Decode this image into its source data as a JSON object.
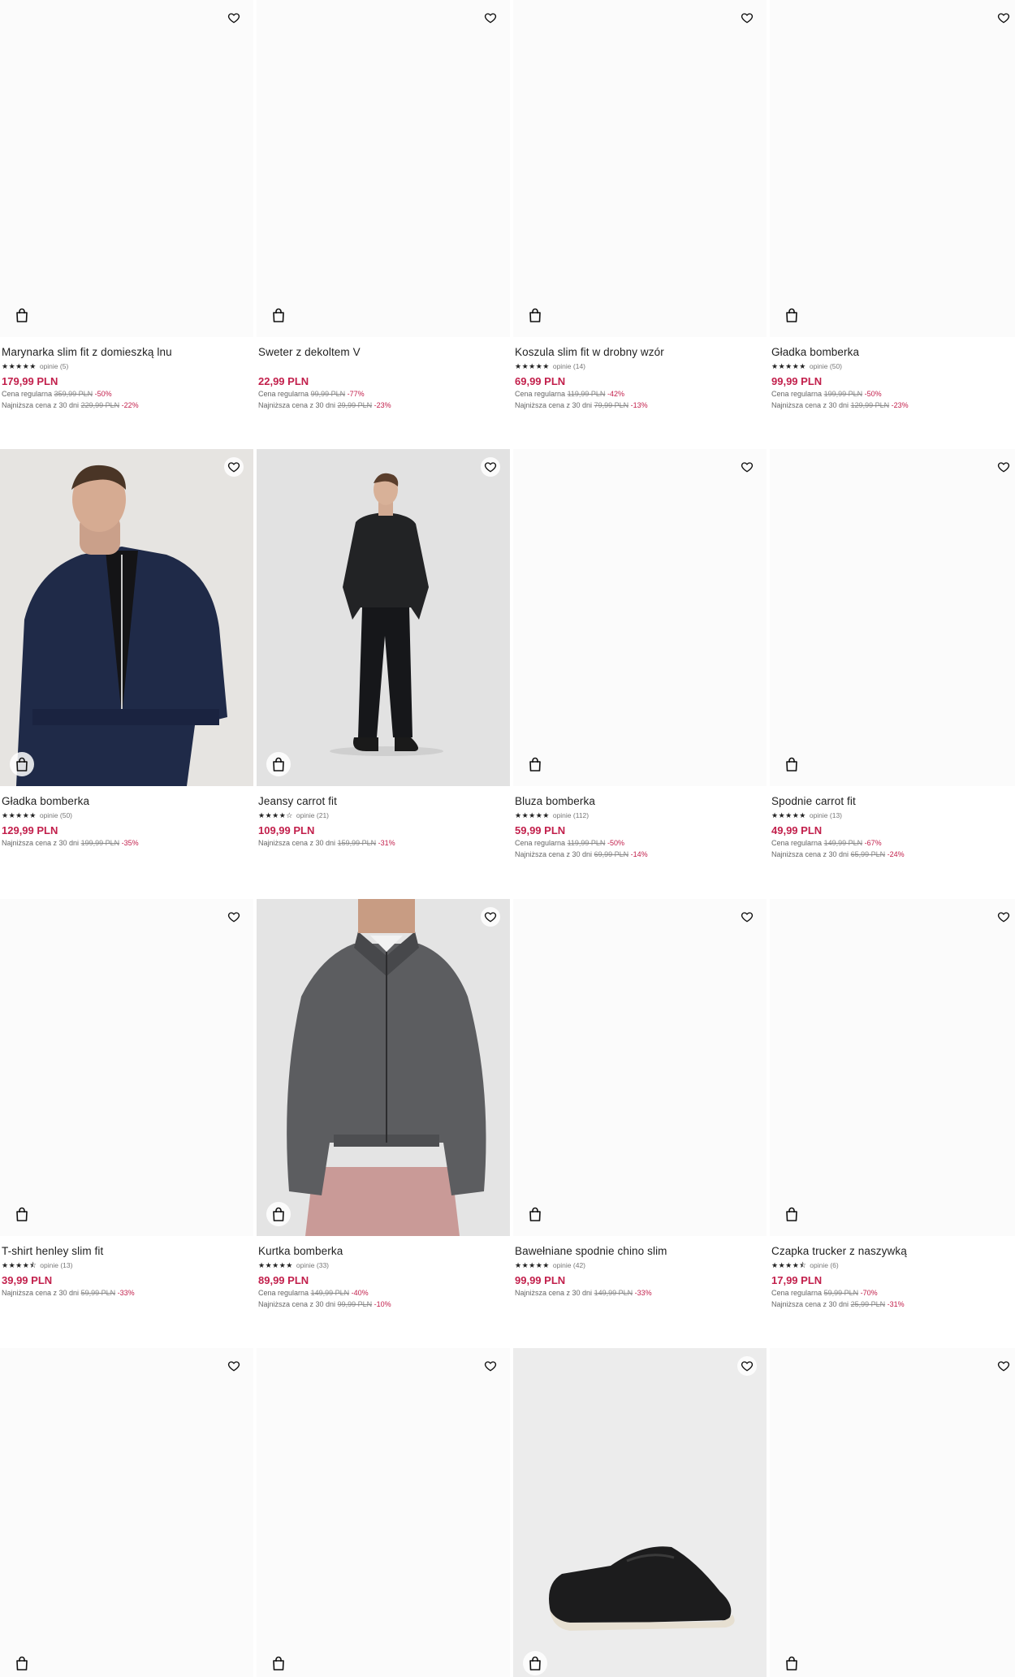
{
  "accent_color": "#c21f4b",
  "icons": {
    "favorite": "heart-outline-icon",
    "bag": "shopping-bag-icon",
    "star": "star-icon"
  },
  "products": [
    {
      "name": "Marynarka slim fit z domieszką lnu",
      "stars": "★★★★★",
      "reviews": "opinie (5)",
      "price": "179,99 PLN",
      "regular_label": "Cena regularna",
      "regular_price": "359,99 PLN",
      "regular_discount": "-50%",
      "lowest_label": "Najniższa cena z 30 dni",
      "lowest_price": "229,99 PLN",
      "lowest_discount": "-22%",
      "photo": "none"
    },
    {
      "name": "Sweter z dekoltem V",
      "stars": "",
      "reviews": "",
      "price": "22,99 PLN",
      "regular_label": "Cena regularna",
      "regular_price": "99,99 PLN",
      "regular_discount": "-77%",
      "lowest_label": "Najniższa cena z 30 dni",
      "lowest_price": "29,99 PLN",
      "lowest_discount": "-23%",
      "photo": "none"
    },
    {
      "name": "Koszula slim fit w drobny wzór",
      "stars": "★★★★★",
      "reviews": "opinie (14)",
      "price": "69,99 PLN",
      "regular_label": "Cena regularna",
      "regular_price": "119,99 PLN",
      "regular_discount": "-42%",
      "lowest_label": "Najniższa cena z 30 dni",
      "lowest_price": "79,99 PLN",
      "lowest_discount": "-13%",
      "photo": "none"
    },
    {
      "name": "Gładka bomberka",
      "stars": "★★★★★",
      "reviews": "opinie (50)",
      "price": "99,99 PLN",
      "regular_label": "Cena regularna",
      "regular_price": "199,99 PLN",
      "regular_discount": "-50%",
      "lowest_label": "Najniższa cena z 30 dni",
      "lowest_price": "129,99 PLN",
      "lowest_discount": "-23%",
      "photo": "none"
    },
    {
      "name": "Gładka bomberka",
      "stars": "★★★★★",
      "reviews": "opinie (50)",
      "price": "129,99 PLN",
      "regular_label": "",
      "regular_price": "",
      "regular_discount": "",
      "lowest_label": "Najniższa cena z 30 dni",
      "lowest_price": "199,99 PLN",
      "lowest_discount": "-35%",
      "photo": "navy-bomber"
    },
    {
      "name": "Jeansy carrot fit",
      "stars": "★★★★☆",
      "reviews": "opinie (21)",
      "price": "109,99 PLN",
      "regular_label": "",
      "regular_price": "",
      "regular_discount": "",
      "lowest_label": "Najniższa cena z 30 dni",
      "lowest_price": "159,99 PLN",
      "lowest_discount": "-31%",
      "photo": "black-jeans"
    },
    {
      "name": "Bluza bomberka",
      "stars": "★★★★★",
      "reviews": "opinie (112)",
      "price": "59,99 PLN",
      "regular_label": "Cena regularna",
      "regular_price": "119,99 PLN",
      "regular_discount": "-50%",
      "lowest_label": "Najniższa cena z 30 dni",
      "lowest_price": "69,99 PLN",
      "lowest_discount": "-14%",
      "photo": "none"
    },
    {
      "name": "Spodnie carrot fit",
      "stars": "★★★★★",
      "reviews": "opinie (13)",
      "price": "49,99 PLN",
      "regular_label": "Cena regularna",
      "regular_price": "149,99 PLN",
      "regular_discount": "-67%",
      "lowest_label": "Najniższa cena z 30 dni",
      "lowest_price": "65,99 PLN",
      "lowest_discount": "-24%",
      "photo": "none"
    },
    {
      "name": "T-shirt henley slim fit",
      "stars": "★★★★⯪",
      "reviews": "opinie (13)",
      "price": "39,99 PLN",
      "regular_label": "",
      "regular_price": "",
      "regular_discount": "",
      "lowest_label": "Najniższa cena z 30 dni",
      "lowest_price": "59,99 PLN",
      "lowest_discount": "-33%",
      "photo": "none"
    },
    {
      "name": "Kurtka bomberka",
      "stars": "★★★★★",
      "reviews": "opinie (33)",
      "price": "89,99 PLN",
      "regular_label": "Cena regularna",
      "regular_price": "149,99 PLN",
      "regular_discount": "-40%",
      "lowest_label": "Najniższa cena z 30 dni",
      "lowest_price": "99,99 PLN",
      "lowest_discount": "-10%",
      "photo": "grey-bomber"
    },
    {
      "name": "Bawełniane spodnie chino slim",
      "stars": "★★★★★",
      "reviews": "opinie (42)",
      "price": "99,99 PLN",
      "regular_label": "",
      "regular_price": "",
      "regular_discount": "",
      "lowest_label": "Najniższa cena z 30 dni",
      "lowest_price": "149,99 PLN",
      "lowest_discount": "-33%",
      "photo": "none"
    },
    {
      "name": "Czapka trucker z naszywką",
      "stars": "★★★★⯪",
      "reviews": "opinie (6)",
      "price": "17,99 PLN",
      "regular_label": "Cena regularna",
      "regular_price": "59,99 PLN",
      "regular_discount": "-70%",
      "lowest_label": "Najniższa cena z 30 dni",
      "lowest_price": "25,99 PLN",
      "lowest_discount": "-31%",
      "photo": "none"
    },
    {
      "name": "",
      "stars": "",
      "reviews": "",
      "price": "",
      "regular_label": "",
      "regular_price": "",
      "regular_discount": "",
      "lowest_label": "",
      "lowest_price": "",
      "lowest_discount": "",
      "photo": "none"
    },
    {
      "name": "",
      "stars": "",
      "reviews": "",
      "price": "",
      "regular_label": "",
      "regular_price": "",
      "regular_discount": "",
      "lowest_label": "",
      "lowest_price": "",
      "lowest_discount": "",
      "photo": "none"
    },
    {
      "name": "",
      "stars": "",
      "reviews": "",
      "price": "",
      "regular_label": "",
      "regular_price": "",
      "regular_discount": "",
      "lowest_label": "",
      "lowest_price": "",
      "lowest_discount": "",
      "photo": "black-loafer"
    },
    {
      "name": "",
      "stars": "",
      "reviews": "",
      "price": "",
      "regular_label": "",
      "regular_price": "",
      "regular_discount": "",
      "lowest_label": "",
      "lowest_price": "",
      "lowest_discount": "",
      "photo": "none"
    }
  ]
}
